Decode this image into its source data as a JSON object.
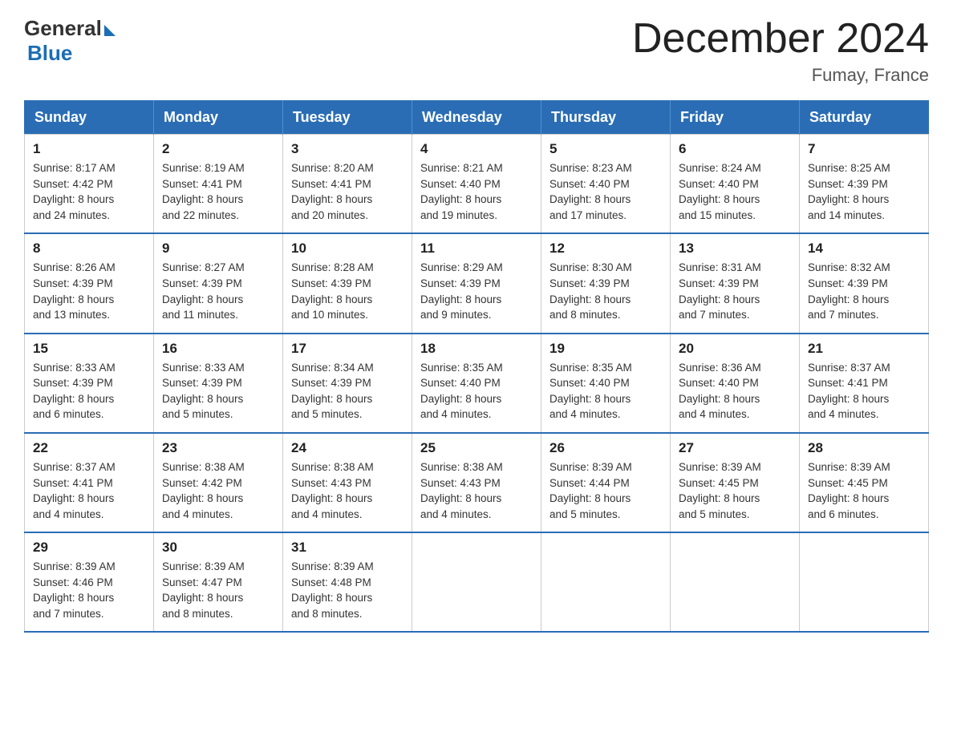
{
  "header": {
    "logo_general": "General",
    "logo_blue": "Blue",
    "month_title": "December 2024",
    "location": "Fumay, France"
  },
  "days_of_week": [
    "Sunday",
    "Monday",
    "Tuesday",
    "Wednesday",
    "Thursday",
    "Friday",
    "Saturday"
  ],
  "weeks": [
    [
      {
        "day": "1",
        "sunrise": "8:17 AM",
        "sunset": "4:42 PM",
        "daylight": "8 hours and 24 minutes."
      },
      {
        "day": "2",
        "sunrise": "8:19 AM",
        "sunset": "4:41 PM",
        "daylight": "8 hours and 22 minutes."
      },
      {
        "day": "3",
        "sunrise": "8:20 AM",
        "sunset": "4:41 PM",
        "daylight": "8 hours and 20 minutes."
      },
      {
        "day": "4",
        "sunrise": "8:21 AM",
        "sunset": "4:40 PM",
        "daylight": "8 hours and 19 minutes."
      },
      {
        "day": "5",
        "sunrise": "8:23 AM",
        "sunset": "4:40 PM",
        "daylight": "8 hours and 17 minutes."
      },
      {
        "day": "6",
        "sunrise": "8:24 AM",
        "sunset": "4:40 PM",
        "daylight": "8 hours and 15 minutes."
      },
      {
        "day": "7",
        "sunrise": "8:25 AM",
        "sunset": "4:39 PM",
        "daylight": "8 hours and 14 minutes."
      }
    ],
    [
      {
        "day": "8",
        "sunrise": "8:26 AM",
        "sunset": "4:39 PM",
        "daylight": "8 hours and 13 minutes."
      },
      {
        "day": "9",
        "sunrise": "8:27 AM",
        "sunset": "4:39 PM",
        "daylight": "8 hours and 11 minutes."
      },
      {
        "day": "10",
        "sunrise": "8:28 AM",
        "sunset": "4:39 PM",
        "daylight": "8 hours and 10 minutes."
      },
      {
        "day": "11",
        "sunrise": "8:29 AM",
        "sunset": "4:39 PM",
        "daylight": "8 hours and 9 minutes."
      },
      {
        "day": "12",
        "sunrise": "8:30 AM",
        "sunset": "4:39 PM",
        "daylight": "8 hours and 8 minutes."
      },
      {
        "day": "13",
        "sunrise": "8:31 AM",
        "sunset": "4:39 PM",
        "daylight": "8 hours and 7 minutes."
      },
      {
        "day": "14",
        "sunrise": "8:32 AM",
        "sunset": "4:39 PM",
        "daylight": "8 hours and 7 minutes."
      }
    ],
    [
      {
        "day": "15",
        "sunrise": "8:33 AM",
        "sunset": "4:39 PM",
        "daylight": "8 hours and 6 minutes."
      },
      {
        "day": "16",
        "sunrise": "8:33 AM",
        "sunset": "4:39 PM",
        "daylight": "8 hours and 5 minutes."
      },
      {
        "day": "17",
        "sunrise": "8:34 AM",
        "sunset": "4:39 PM",
        "daylight": "8 hours and 5 minutes."
      },
      {
        "day": "18",
        "sunrise": "8:35 AM",
        "sunset": "4:40 PM",
        "daylight": "8 hours and 4 minutes."
      },
      {
        "day": "19",
        "sunrise": "8:35 AM",
        "sunset": "4:40 PM",
        "daylight": "8 hours and 4 minutes."
      },
      {
        "day": "20",
        "sunrise": "8:36 AM",
        "sunset": "4:40 PM",
        "daylight": "8 hours and 4 minutes."
      },
      {
        "day": "21",
        "sunrise": "8:37 AM",
        "sunset": "4:41 PM",
        "daylight": "8 hours and 4 minutes."
      }
    ],
    [
      {
        "day": "22",
        "sunrise": "8:37 AM",
        "sunset": "4:41 PM",
        "daylight": "8 hours and 4 minutes."
      },
      {
        "day": "23",
        "sunrise": "8:38 AM",
        "sunset": "4:42 PM",
        "daylight": "8 hours and 4 minutes."
      },
      {
        "day": "24",
        "sunrise": "8:38 AM",
        "sunset": "4:43 PM",
        "daylight": "8 hours and 4 minutes."
      },
      {
        "day": "25",
        "sunrise": "8:38 AM",
        "sunset": "4:43 PM",
        "daylight": "8 hours and 4 minutes."
      },
      {
        "day": "26",
        "sunrise": "8:39 AM",
        "sunset": "4:44 PM",
        "daylight": "8 hours and 5 minutes."
      },
      {
        "day": "27",
        "sunrise": "8:39 AM",
        "sunset": "4:45 PM",
        "daylight": "8 hours and 5 minutes."
      },
      {
        "day": "28",
        "sunrise": "8:39 AM",
        "sunset": "4:45 PM",
        "daylight": "8 hours and 6 minutes."
      }
    ],
    [
      {
        "day": "29",
        "sunrise": "8:39 AM",
        "sunset": "4:46 PM",
        "daylight": "8 hours and 7 minutes."
      },
      {
        "day": "30",
        "sunrise": "8:39 AM",
        "sunset": "4:47 PM",
        "daylight": "8 hours and 8 minutes."
      },
      {
        "day": "31",
        "sunrise": "8:39 AM",
        "sunset": "4:48 PM",
        "daylight": "8 hours and 8 minutes."
      },
      null,
      null,
      null,
      null
    ]
  ],
  "labels": {
    "sunrise": "Sunrise:",
    "sunset": "Sunset:",
    "daylight": "Daylight:"
  }
}
